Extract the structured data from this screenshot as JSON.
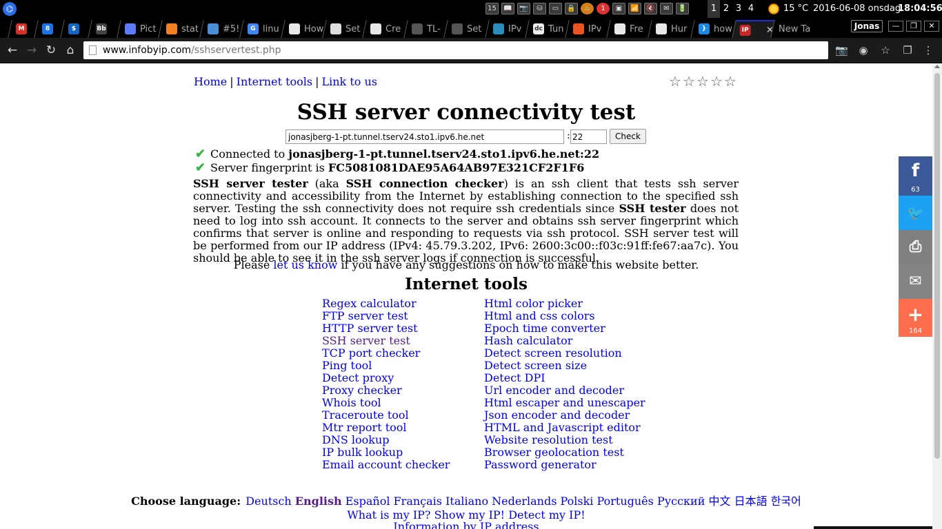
{
  "system_panel": {
    "logo_glyph": "⌬",
    "tray_items": [
      "15",
      "📖",
      "📷",
      "⛁",
      "▭",
      "🔒",
      "♨",
      "1",
      "▣",
      "📶",
      "🔇",
      "✉",
      "🔋"
    ],
    "workspaces": [
      "1",
      "2",
      "3",
      "4"
    ],
    "active_workspace": "1",
    "weather_temp": "15 °C",
    "date": "2016-06-08 onsdag",
    "time": "18:04:56"
  },
  "tabs": [
    {
      "title": "",
      "fav": "M",
      "color": "#d93025"
    },
    {
      "title": "",
      "fav": "8",
      "color": "#1a73e8"
    },
    {
      "title": "",
      "fav": "$",
      "color": "#1565c0"
    },
    {
      "title": "",
      "fav": "Bb",
      "color": "#444444"
    },
    {
      "title": "Pict",
      "fav": "",
      "color": "#5c7cfa"
    },
    {
      "title": "stat",
      "fav": "",
      "color": "#f48024"
    },
    {
      "title": "#5!",
      "fav": "",
      "color": "#4a90d9"
    },
    {
      "title": "linu",
      "fav": "G",
      "color": "#4285f4"
    },
    {
      "title": "How",
      "fav": "",
      "color": "#e8e8e8"
    },
    {
      "title": "Set",
      "fav": "",
      "color": "#dddddd"
    },
    {
      "title": "Cre",
      "fav": "",
      "color": "#e8e8e8"
    },
    {
      "title": "TL-",
      "fav": "",
      "color": "#555555"
    },
    {
      "title": "Set",
      "fav": "",
      "color": "#555555"
    },
    {
      "title": "IPv",
      "fav": "",
      "color": "#2b8cbe"
    },
    {
      "title": "Tun",
      "fav": "dc",
      "color": "#eeeeee"
    },
    {
      "title": "IPv",
      "fav": "",
      "color": "#e95420"
    },
    {
      "title": "Fre",
      "fav": "",
      "color": "#e8e8e8"
    },
    {
      "title": "Hur",
      "fav": "",
      "color": "#e8e8e8"
    },
    {
      "title": "how",
      "fav": "}",
      "color": "#1e88e5"
    },
    {
      "title": "",
      "fav": "IP",
      "color": "#c62828",
      "active": true
    },
    {
      "title": "New Ta",
      "fav": "",
      "color": "transparent"
    }
  ],
  "window": {
    "profile_name": "Jonas",
    "minimize": "—",
    "restore": "❐",
    "close": "✕"
  },
  "toolbar": {
    "back": "←",
    "forward": "→",
    "reload": "↻",
    "home": "⌂",
    "url_host": "www.infobyip.com",
    "url_path": "/sshservertest.php",
    "right_icons": [
      "📷",
      "◉",
      "☆",
      "❐",
      "⋮"
    ]
  },
  "page": {
    "nav": {
      "home": "Home",
      "sep": "|",
      "internet_tools": "Internet tools",
      "link_to_us": "Link to us"
    },
    "rating_stars": [
      "☆",
      "☆",
      "☆",
      "☆",
      "☆"
    ],
    "title": "SSH server connectivity test",
    "form": {
      "host_value": "jonasjberg-1-pt.tunnel.tserv24.sto1.ipv6.he.net",
      "colon": ":",
      "port_value": "22",
      "check_label": "Check"
    },
    "results": [
      {
        "prefix": "Connected to ",
        "value": "jonasjberg-1-pt.tunnel.tserv24.sto1.ipv6.he.net:22"
      },
      {
        "prefix": "Server fingerprint is ",
        "value": "FC5081081DAE95A64AB97E321CF2F1F6"
      }
    ],
    "description": {
      "b1": "SSH server tester",
      "t1": " (aka ",
      "b2": "SSH connection checker",
      "t2": ") is an ssh client that tests ssh server connectivity and accessibility from the Internet by establishing connection to the specified ssh server. Testing the ssh connectivity does not require ssh credentials since ",
      "b3": "SSH tester",
      "t3": " does not need to log into ssh account. It connects to the server and obtains ssh server fingerprint which confirms that server is online and responding to requests via ssh protocol. SSH server test will be performed from our IP address (IPv4: 45.79.3.202, IPv6: 2600:3c00::f03c:91ff:fe67:aa7c). You should be able to see it in the ssh server logs if connection is successful."
    },
    "feedback": {
      "before": "Please ",
      "link": "let us know",
      "after": " if you have any suggestions on how to make this website better."
    },
    "tools_heading": "Internet tools",
    "tools_left": [
      "Regex calculator",
      "FTP server test",
      "HTTP server test",
      "SSH server test",
      "TCP port checker",
      "Ping tool",
      "Detect proxy",
      "Proxy checker",
      "Whois tool",
      "Traceroute tool",
      "Mtr report tool",
      "DNS lookup",
      "IP bulk lookup",
      "Email account checker"
    ],
    "tools_right": [
      "Html color picker",
      "Html and css colors",
      "Epoch time converter",
      "Hash calculator",
      "Detect screen resolution",
      "Detect screen size",
      "Detect DPI",
      "Url encoder and decoder",
      "Html escaper and unescaper",
      "Json encoder and decoder",
      "HTML and Javascript editor",
      "Website resolution test",
      "Browser geolocation test",
      "Password generator"
    ],
    "visited_tool": "SSH server test",
    "languages_label": "Choose language:",
    "languages": [
      "Deutsch",
      "English",
      "Español",
      "Français",
      "Italiano",
      "Nederlands",
      "Polski",
      "Português",
      "Русский",
      "中文",
      "日本語",
      "한국어"
    ],
    "current_language": "English",
    "footer_links": [
      "What is my IP?",
      "Show my IP!",
      "Detect my IP!"
    ],
    "footer_links2": [
      "Information by IP address"
    ]
  },
  "share": {
    "facebook": {
      "glyph": "f",
      "count": "63"
    },
    "twitter": {
      "glyph": "🐦"
    },
    "print": {
      "glyph": "⎙"
    },
    "email": {
      "glyph": "✉"
    },
    "more": {
      "glyph": "+",
      "count": "164"
    }
  }
}
